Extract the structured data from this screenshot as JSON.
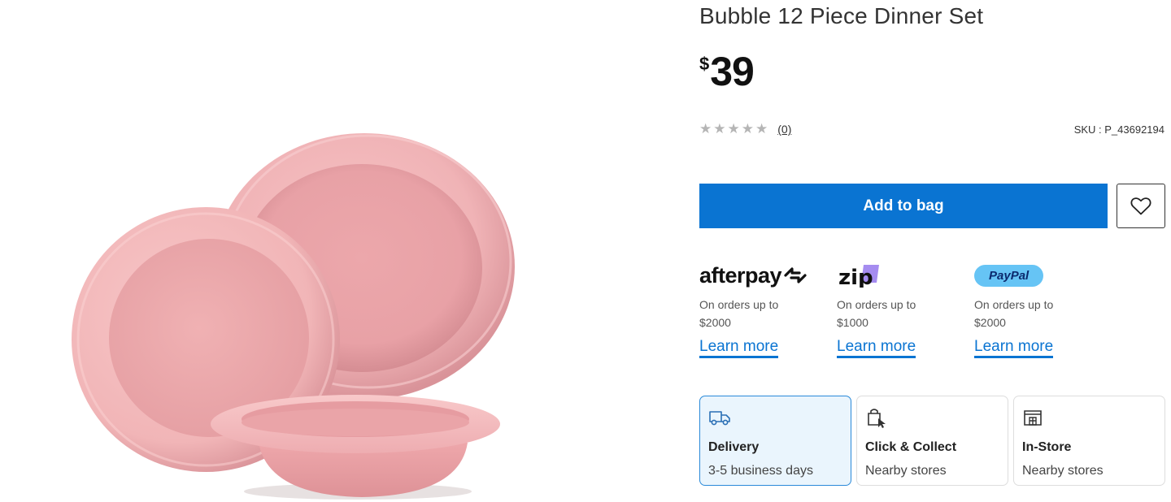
{
  "product": {
    "title": "Bubble 12 Piece Dinner Set",
    "price_currency": "$",
    "price_amount": "39",
    "rating_stars": 0,
    "review_count": "(0)",
    "sku": "SKU : P_43692194",
    "image_alt": "Pink plates and bowl"
  },
  "actions": {
    "add_to_bag": "Add to bag",
    "wishlist_icon": "heart-icon"
  },
  "payments": [
    {
      "name": "afterpay",
      "logo_text": "afterpay",
      "desc": "On orders up to $2000",
      "link": "Learn more"
    },
    {
      "name": "zip",
      "logo_text": "zip",
      "desc": "On orders up to $1000",
      "link": "Learn more"
    },
    {
      "name": "paypal",
      "logo_text": "PayPal",
      "desc": "On orders up to $2000",
      "link": "Learn more"
    }
  ],
  "fulfilment": [
    {
      "icon": "truck-icon",
      "title": "Delivery",
      "subtitle": "3-5 business days",
      "selected": true
    },
    {
      "icon": "click-collect-icon",
      "title": "Click & Collect",
      "subtitle": "Nearby stores",
      "selected": false
    },
    {
      "icon": "store-icon",
      "title": "In-Store",
      "subtitle": "Nearby stores",
      "selected": false
    }
  ],
  "colors": {
    "primary": "#0a74d2",
    "plate": "#eca7ad",
    "paypal_badge": "#66c4f5"
  }
}
